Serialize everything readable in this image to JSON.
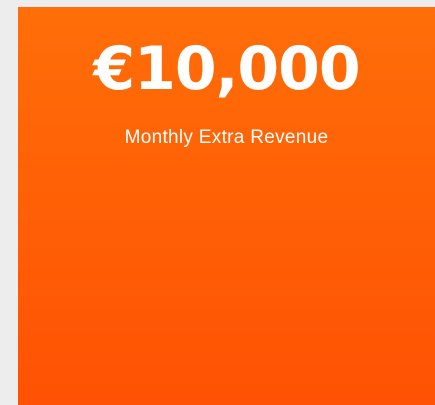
{
  "stat_card": {
    "value": "€10,000",
    "label": "Monthly Extra Revenue"
  },
  "colors": {
    "page_background": "#ededed",
    "card_gradient_top": "#ff6e08",
    "card_gradient_bottom": "#ff5204",
    "text": "#ffffff"
  }
}
